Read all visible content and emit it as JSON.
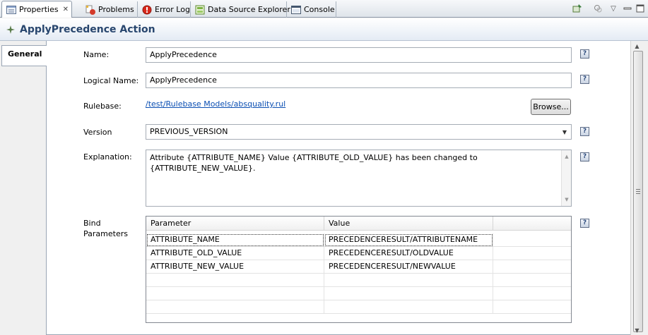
{
  "tabs": [
    {
      "label": "Properties",
      "icon": "properties-icon",
      "active": true,
      "closable": true
    },
    {
      "label": "Problems",
      "icon": "problems-icon"
    },
    {
      "label": "Error Log",
      "icon": "error-log-icon"
    },
    {
      "label": "Data Source Explorer",
      "icon": "data-source-explorer-icon"
    },
    {
      "label": "Console",
      "icon": "console-icon"
    }
  ],
  "view_toolbar": [
    "pin-icon",
    "filter-icon",
    "view-menu-icon",
    "minimize-icon",
    "maximize-icon"
  ],
  "header": {
    "title": "ApplyPrecedence Action",
    "icon": "action-icon"
  },
  "side_tabs": [
    {
      "label": "General",
      "active": true
    }
  ],
  "form": {
    "name": {
      "label": "Name:",
      "value": "ApplyPrecedence"
    },
    "logical_name": {
      "label": "Logical Name:",
      "value": "ApplyPrecedence"
    },
    "rulebase": {
      "label": "Rulebase:",
      "link": "/test/Rulebase Models/absquality.rul",
      "browse_label": "Browse..."
    },
    "version": {
      "label": "Version",
      "value": "PREVIOUS_VERSION"
    },
    "explanation": {
      "label": "Explanation:",
      "line1": "Attribute {ATTRIBUTE_NAME} Value {ATTRIBUTE_OLD_VALUE} has been changed to",
      "line2": "{ATTRIBUTE_NEW_VALUE}."
    },
    "bind_parameters": {
      "label_line1": "Bind",
      "label_line2": "Parameters",
      "columns": [
        "Parameter",
        "Value",
        ""
      ],
      "rows": [
        [
          "ATTRIBUTE_NAME",
          "PRECEDENCERESULT/ATTRIBUTENAME"
        ],
        [
          "ATTRIBUTE_OLD_VALUE",
          "PRECEDENCERESULT/OLDVALUE"
        ],
        [
          "ATTRIBUTE_NEW_VALUE",
          "PRECEDENCERESULT/NEWVALUE"
        ],
        [
          "",
          ""
        ],
        [
          "",
          ""
        ],
        [
          "",
          ""
        ]
      ]
    },
    "help_glyph": "?"
  },
  "colors": {
    "title": "#28466e",
    "link": "#0b4fb3"
  }
}
